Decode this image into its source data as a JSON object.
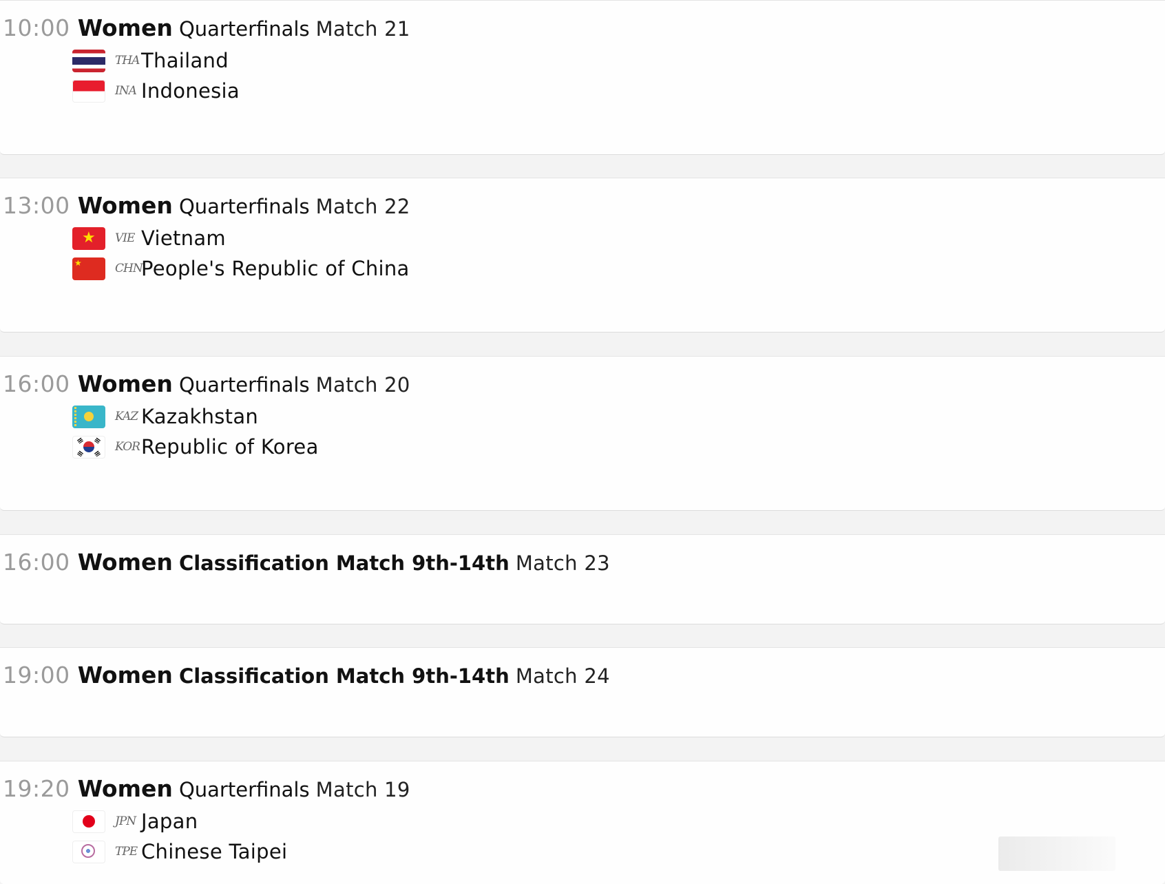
{
  "schedule": [
    {
      "time": "10:00",
      "gender": "Women",
      "phase": "Quarterfinals",
      "match": "Match 21",
      "teams": [
        {
          "code": "THA",
          "name": "Thailand",
          "flag": "thailand-flag-icon"
        },
        {
          "code": "INA",
          "name": "Indonesia",
          "flag": "indonesia-flag-icon"
        }
      ]
    },
    {
      "time": "13:00",
      "gender": "Women",
      "phase": "Quarterfinals",
      "match": "Match 22",
      "teams": [
        {
          "code": "VIE",
          "name": "Vietnam",
          "flag": "vietnam-flag-icon"
        },
        {
          "code": "CHN",
          "name": "People's Republic of China",
          "flag": "china-flag-icon"
        }
      ]
    },
    {
      "time": "16:00",
      "gender": "Women",
      "phase": "Quarterfinals",
      "match": "Match 20",
      "teams": [
        {
          "code": "KAZ",
          "name": "Kazakhstan",
          "flag": "kazakhstan-flag-icon"
        },
        {
          "code": "KOR",
          "name": "Republic of Korea",
          "flag": "korea-flag-icon"
        }
      ]
    },
    {
      "time": "16:00",
      "gender": "Women",
      "phase": "Classification Match 9th-14th",
      "match": "Match 23",
      "teams": []
    },
    {
      "time": "19:00",
      "gender": "Women",
      "phase": "Classification Match 9th-14th",
      "match": "Match 24",
      "teams": []
    },
    {
      "time": "19:20",
      "gender": "Women",
      "phase": "Quarterfinals",
      "match": "Match 19",
      "teams": [
        {
          "code": "JPN",
          "name": "Japan",
          "flag": "japan-flag-icon"
        },
        {
          "code": "TPE",
          "name": "Chinese Taipei",
          "flag": "chinese-taipei-flag-icon"
        }
      ]
    }
  ]
}
